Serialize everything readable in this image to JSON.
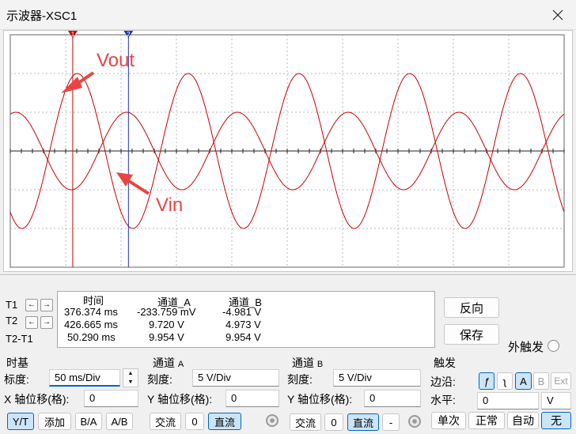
{
  "window": {
    "title": "示波器-XSC1"
  },
  "annotations": {
    "vout_label": "Vout",
    "vin_label": "Vin"
  },
  "colors": {
    "trace": "#cc0000",
    "cursor1": "#cc0000",
    "cursor2": "#2233aa",
    "grid": "#b8b8b8",
    "annotation": "#e84444"
  },
  "cursors": {
    "t1_label": "T1",
    "t2_label": "T2",
    "diff_label": "T2-T1",
    "left_arrow": "←",
    "right_arrow": "→"
  },
  "readout": {
    "headers": [
      "时间",
      "通道_A",
      "通道_B"
    ],
    "rows": [
      [
        "376.374 ms",
        "-233.759 mV",
        "-4.981 V"
      ],
      [
        "426.665 ms",
        "9.720 V",
        "4.973 V"
      ],
      [
        "50.290 ms",
        "9.954 V",
        "9.954 V"
      ]
    ]
  },
  "buttons": {
    "reverse": "反向",
    "save": "保存",
    "ext_trigger": "外触发"
  },
  "timebase": {
    "title": "时基",
    "scale_label": "标度:",
    "scale_value": "50 ms/Div",
    "xpos_label": "X 轴位移(格):",
    "xpos_value": "0",
    "modes": [
      "Y/T",
      "添加",
      "B/A",
      "A/B"
    ],
    "selected_mode": "Y/T"
  },
  "channel_a": {
    "title_main": "通道",
    "title_sub": "A",
    "scale_label": "刻度:",
    "scale_value": "5  V/Div",
    "ypos_label": "Y 轴位移(格):",
    "ypos_value": "0",
    "coupling": [
      "交流",
      "0",
      "直流"
    ],
    "selected": "直流"
  },
  "channel_b": {
    "title_main": "通道",
    "title_sub": "B",
    "scale_label": "刻度:",
    "scale_value": "5  V/Div",
    "ypos_label": "Y 轴位移(格):",
    "ypos_value": "0",
    "coupling": [
      "交流",
      "0",
      "直流",
      "-"
    ],
    "selected": "直流"
  },
  "trigger": {
    "title": "触发",
    "edge_label": "边沿:",
    "edge_rise": "ƒ",
    "edge_fall": "ʅ",
    "sources": [
      "A",
      "B",
      "Ext"
    ],
    "selected_source": "A",
    "level_label": "水平:",
    "level_value": "0",
    "level_unit": "V",
    "modes": [
      "单次",
      "正常",
      "自动",
      "无"
    ],
    "selected_mode": "无"
  },
  "chart_data": {
    "type": "line",
    "xlabel": "",
    "ylabel": "",
    "x_divisions": 10,
    "y_divisions": 6,
    "time_per_div_ms": 50,
    "volts_per_div": 5,
    "period_ms": 100,
    "series": [
      {
        "amplitude_v": 10,
        "phase_deg": 160
      },
      {
        "amplitude_v": 5,
        "phase_deg": 0
      }
    ],
    "cursor_t1_ms": 376.374,
    "cursor_t2_ms": 426.665,
    "view_start_ms": 320
  }
}
